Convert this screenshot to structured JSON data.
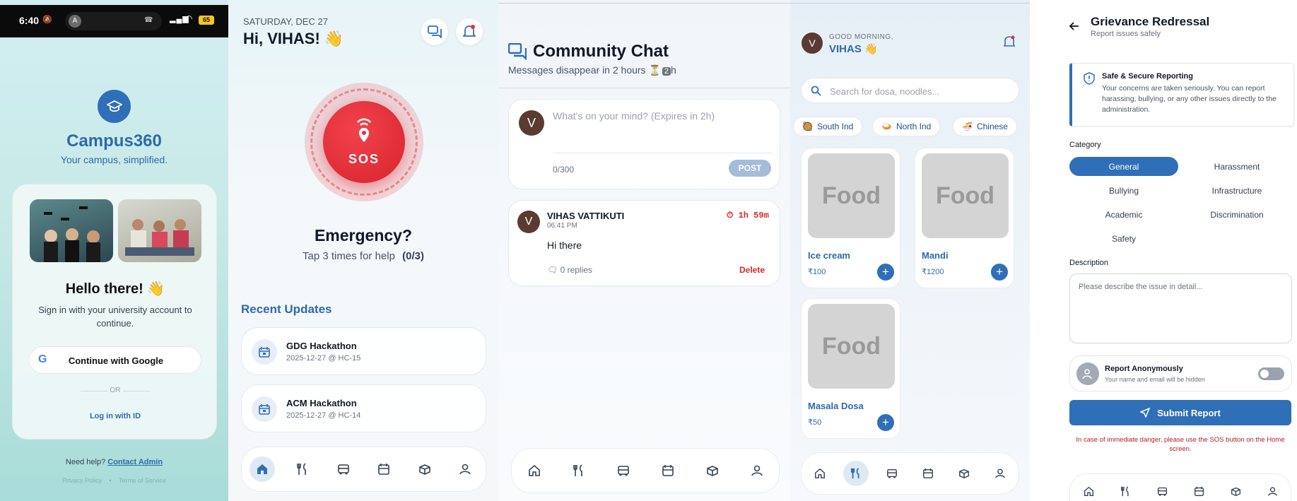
{
  "login": {
    "status_time": "6:40",
    "status_avatar_letter": "A",
    "battery": "65",
    "app_name": "Campus360",
    "tagline": "Your campus, simplified.",
    "hello": "Hello there! 👋",
    "subtitle": "Sign in with your university account to continue.",
    "google_button": "Continue with Google",
    "or": "OR",
    "login_id": "Log in with ID",
    "need_help": "Need help?",
    "contact_admin": "Contact Admin",
    "privacy": "Privacy Policy",
    "bullet": "•",
    "terms": "Terms of Service"
  },
  "home": {
    "date": "SATURDAY, DEC 27",
    "greeting": "Hi, VIHAS! 👋",
    "sos_label": "SOS",
    "emergency_title": "Emergency?",
    "tap_hint": "Tap 3 times for help",
    "tap_count": "(0/3)",
    "recent_updates": "Recent Updates",
    "updates": [
      {
        "title": "GDG Hackathon",
        "subtitle": "2025-12-27 @ HC-15"
      },
      {
        "title": "ACM Hackathon",
        "subtitle": "2025-12-27 @ HC-14"
      }
    ]
  },
  "chat": {
    "title": "Community Chat",
    "subtitle": "Messages disappear in 2 hours ⏳",
    "subtitle_badge": "2",
    "subtitle_unit": "h",
    "composer_avatar": "V",
    "placeholder": "What's on your mind? (Expires in 2h)",
    "char_count": "0/300",
    "post_button": "POST",
    "post": {
      "avatar": "V",
      "author": "VIHAS VATTIKUTI",
      "time": "06:41 PM",
      "expires": "1h 59m",
      "message": "Hi there",
      "replies": "0 replies",
      "delete": "Delete"
    }
  },
  "food": {
    "avatar": "V",
    "good_morning": "GOOD MORNING,",
    "name": "VIHAS 👋",
    "search_placeholder": "Search for dosa, noodles...",
    "chips": [
      "South Ind",
      "North Ind",
      "Chinese"
    ],
    "items": [
      {
        "image_text": "Food",
        "name": "Ice cream",
        "price": "₹100"
      },
      {
        "image_text": "Food",
        "name": "Mandi",
        "price": "₹1200"
      },
      {
        "image_text": "Food",
        "name": "Masala Dosa",
        "price": "₹50"
      }
    ]
  },
  "grievance": {
    "title": "Grievance Redressal",
    "subtitle": "Report issues safely",
    "info_title": "Safe & Secure Reporting",
    "info_text": "Your concerns are taken seriously. You can report harassing, bullying, or any other issues directly to the administration.",
    "category_label": "Category",
    "categories": [
      "General",
      "Harassment",
      "Bullying",
      "Infrastructure",
      "Academic",
      "Discrimination",
      "Safety"
    ],
    "selected_category": "General",
    "description_label": "Description",
    "description_placeholder": "Please describe the issue in detail...",
    "anon_title": "Report Anonymously",
    "anon_subtitle": "Your name and email will be hidden",
    "anon_enabled": false,
    "submit": "Submit Report",
    "footer_note": "In case of immediate danger, please use the SOS button on the Home screen."
  },
  "nav_icons": [
    "home-icon",
    "food-icon",
    "bus-icon",
    "calendar-icon",
    "package-icon",
    "profile-icon"
  ],
  "colors": {
    "primary": "#2f6fb7",
    "sos_red": "#e5303a",
    "delete_red": "#dc2626",
    "heading_blue": "#2e6aa8"
  }
}
